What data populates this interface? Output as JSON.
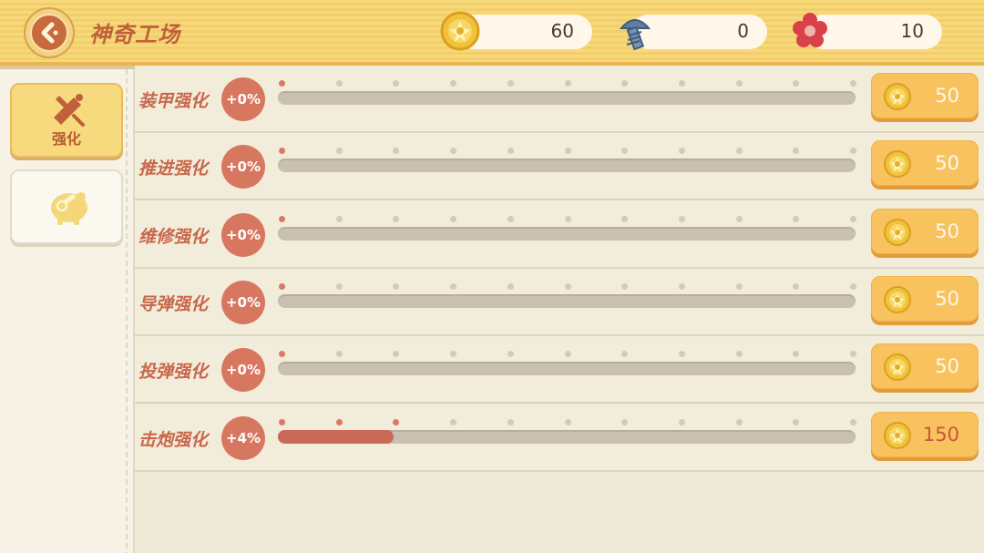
{
  "header": {
    "title": "神奇工场",
    "resources": [
      {
        "name": "coin",
        "icon": "gold-coin-icon",
        "value": "60"
      },
      {
        "name": "screw",
        "icon": "screw-icon",
        "value": "0"
      },
      {
        "name": "flower",
        "icon": "red-flower-icon",
        "value": "10"
      }
    ]
  },
  "sidebar": {
    "tabs": [
      {
        "label": "强化",
        "icon": "upgrade-tool-icon",
        "active": true
      },
      {
        "label": "",
        "icon": "piggy-bank-icon",
        "active": false
      }
    ]
  },
  "upgrades": [
    {
      "label": "装甲强化",
      "percent": "+0%",
      "level_fraction": 0.0,
      "cost": "50",
      "cost_affordable": true
    },
    {
      "label": "推进强化",
      "percent": "+0%",
      "level_fraction": 0.0,
      "cost": "50",
      "cost_affordable": true
    },
    {
      "label": "维修强化",
      "percent": "+0%",
      "level_fraction": 0.0,
      "cost": "50",
      "cost_affordable": true
    },
    {
      "label": "导弹强化",
      "percent": "+0%",
      "level_fraction": 0.0,
      "cost": "50",
      "cost_affordable": true
    },
    {
      "label": "投弹强化",
      "percent": "+0%",
      "level_fraction": 0.0,
      "cost": "50",
      "cost_affordable": true
    },
    {
      "label": "击炮强化",
      "percent": "+4%",
      "level_fraction": 0.2,
      "cost": "150",
      "cost_affordable": false
    }
  ],
  "colors": {
    "accent": "#c96a57",
    "header_bg": "#f7d97c",
    "button": "#f8c25e",
    "cost_unaffordable": "#c9553c"
  }
}
